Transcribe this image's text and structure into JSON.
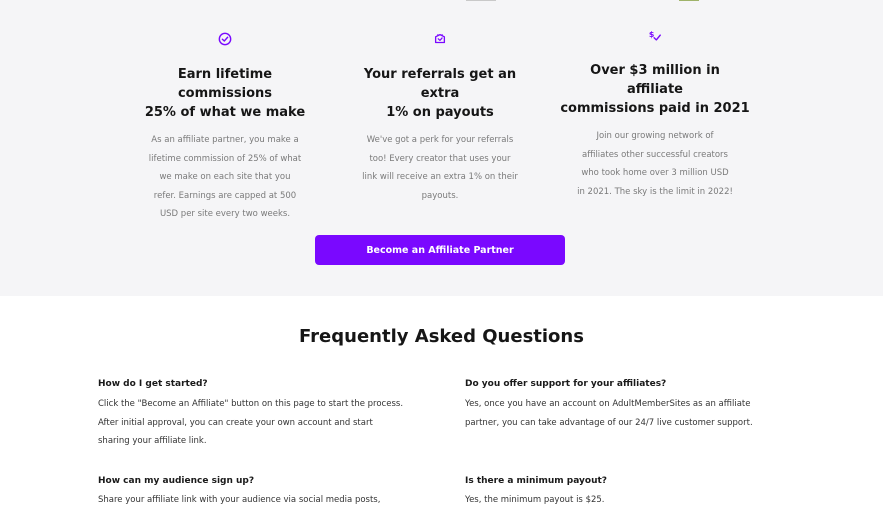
{
  "features": [
    {
      "icon": "check-circle-icon",
      "title_lines": [
        "Earn lifetime commissions",
        "25% of what we make"
      ],
      "desc_lines": [
        "As an affiliate partner, you make a",
        "lifetime commission of 25% of what",
        "we make on each site that you",
        "refer. Earnings are capped at 500",
        "USD per site every two weeks."
      ]
    },
    {
      "icon": "box-icon",
      "title_lines": [
        "Your referrals get an extra",
        "1% on payouts"
      ],
      "desc_lines": [
        "We've got a perk for your referrals",
        "too! Every creator that uses your",
        "link will receive an extra 1% on their",
        "payouts."
      ]
    },
    {
      "icon": "dollar-check-icon",
      "title_lines": [
        "Over $3 million in affiliate",
        "commissions paid in 2021"
      ],
      "desc_lines": [
        "Join our growing network of",
        "affiliates other successful creators",
        "who took home over 3 million USD",
        "in 2021. The sky is the limit in 2022!"
      ]
    }
  ],
  "cta_label": "Become an Affiliate Partner",
  "faq": {
    "title": "Frequently Asked Questions",
    "items": [
      {
        "question": "How do I get started?",
        "answer_lines": [
          "Click the \"Become an Affiliate\" button on this page to start the process.",
          "After initial approval, you can create your own account and start",
          "sharing your affiliate link."
        ]
      },
      {
        "question": "Do you offer support for your affiliates?",
        "answer_lines": [
          "Yes, once you have an account on AdultMemberSites as an affiliate",
          "partner, you can take advantage of our 24/7 live customer support."
        ]
      },
      {
        "question": "How can my audience sign up?",
        "answer_lines": [
          "Share your affiliate link with your audience via social media posts,"
        ]
      },
      {
        "question": "Is there a minimum payout?",
        "answer_lines": [
          "Yes, the minimum payout is $25."
        ]
      }
    ]
  },
  "colors": {
    "accent": "#7a08ff",
    "section_bg": "#f5f5f7"
  }
}
